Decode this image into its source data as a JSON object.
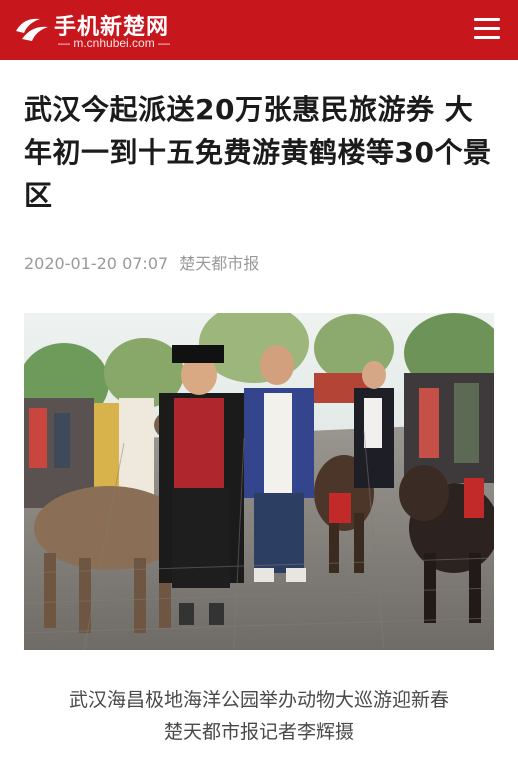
{
  "header": {
    "site_name": "手机新楚网",
    "domain": "m.cnhubei.com",
    "brand_color": "#c8161d",
    "logo_icon": "cnhubei-logo-icon",
    "menu_icon": "hamburger-menu-icon"
  },
  "article": {
    "title": "武汉今起派送20万张惠民旅游券 大年初一到十五免费游黄鹤楼等30个景区",
    "timestamp": "2020-01-20 07:07",
    "source": "楚天都市报"
  },
  "photo": {
    "caption_line1": "武汉海昌极地海洋公园举办动物大巡游迎新春",
    "caption_line2": "楚天都市报记者李辉摄"
  }
}
